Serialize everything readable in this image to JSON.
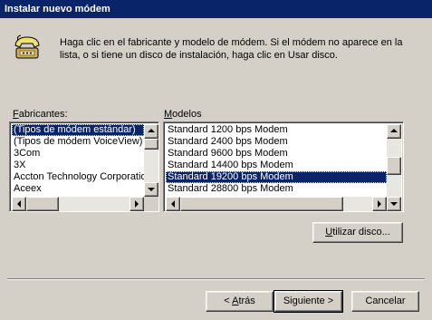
{
  "window": {
    "title": "Instalar nuevo módem"
  },
  "header": {
    "icon": "telephone-modem-icon",
    "text": "Haga clic en el fabricante y modelo de módem. Si el módem no aparece en la lista, o si tiene un disco de instalación, haga clic en Usar disco."
  },
  "manufacturers": {
    "label_hotkey": "F",
    "label_rest": "abricantes:",
    "items": [
      "(Tipos de módem estándar)",
      "(Tipos de módem VoiceView)",
      "3Com",
      "3X",
      "Accton Technology Corporation",
      "Aceex"
    ],
    "selected_index": 0
  },
  "models": {
    "label_hotkey": "M",
    "label_rest": "odelos",
    "items": [
      "Standard  1200 bps Modem",
      "Standard  2400 bps Modem",
      "Standard  9600 bps Modem",
      "Standard 14400 bps Modem",
      "Standard 19200 bps Modem",
      "Standard 28800 bps Modem"
    ],
    "selected_index": 4
  },
  "buttons": {
    "use_disk_hotkey": "U",
    "use_disk_rest": "tilizar disco...",
    "back_prefix": "< ",
    "back_hotkey": "A",
    "back_rest": "trás",
    "next": "Siguiente >",
    "cancel": "Cancelar"
  },
  "colors": {
    "titlebar": "#0a246a",
    "face": "#d4d0c8",
    "selection": "#0a246a"
  }
}
